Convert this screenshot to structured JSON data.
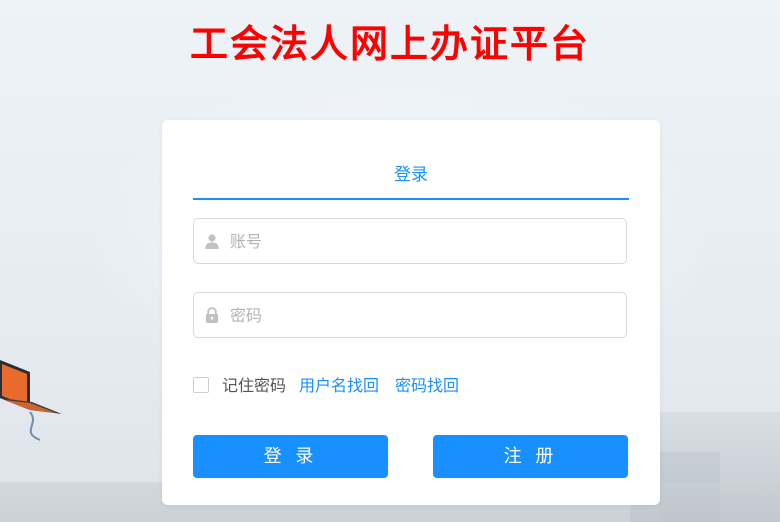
{
  "header": {
    "title": "工会法人网上办证平台"
  },
  "login_form": {
    "tab_label": "登录",
    "account": {
      "placeholder": "账号",
      "value": "",
      "icon": "user-icon"
    },
    "password": {
      "placeholder": "密码",
      "value": "",
      "icon": "lock-icon"
    },
    "remember_label": "记住密码",
    "remember_checked": false,
    "forgot_username_link": "用户名找回",
    "forgot_password_link": "密码找回",
    "login_button": "登 录",
    "register_button": "注 册"
  },
  "colors": {
    "title": "#ff0000",
    "accent": "#1890ff"
  }
}
